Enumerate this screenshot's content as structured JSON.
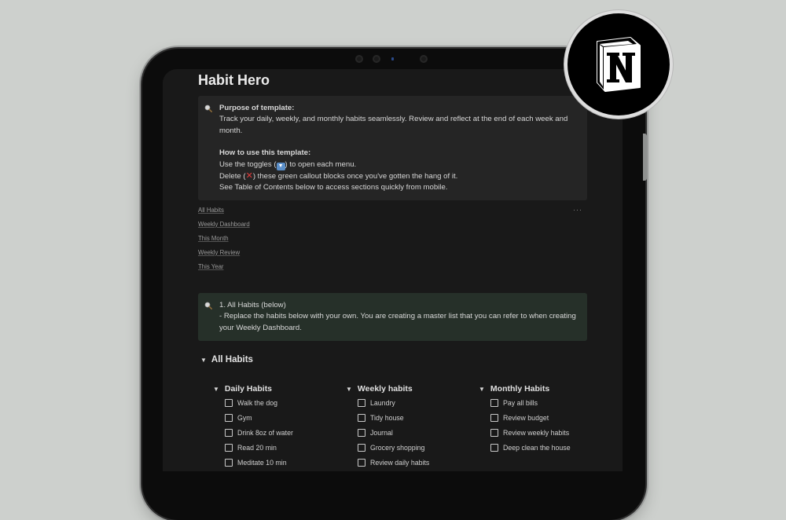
{
  "page": {
    "title": "Habit Hero"
  },
  "callout_purpose": {
    "icon": "magnifier-icon",
    "heading1": "Purpose of template:",
    "text1": "Track your daily, weekly, and monthly habits seamlessly. Review and reflect at the end of each week and month.",
    "heading2": "How to use this template:",
    "line_toggles_a": "Use the toggles (",
    "line_toggles_b": ") to open each menu.",
    "line_delete_a": "Delete (",
    "line_delete_b": ") these green callout blocks once you've gotten the hang of it.",
    "line_toc": "See Table of Contents below to access sections quickly from mobile."
  },
  "toc": {
    "links": [
      "All Habits",
      "Weekly Dashboard",
      "This Month",
      "Weekly Review",
      "This Year"
    ],
    "more": "···"
  },
  "callout_all_habits": {
    "icon": "magnifier-icon",
    "heading": "1. All Habits (below)",
    "text": "- Replace the habits below with your own. You are creating a master list that you can refer to when creating your Weekly Dashboard."
  },
  "all_habits_toggle": {
    "label": "All Habits"
  },
  "columns": [
    {
      "title": "Daily Habits",
      "items": [
        "Walk the dog",
        "Gym",
        "Drink 8oz of water",
        "Read 20 min",
        "Meditate 10 min"
      ]
    },
    {
      "title": "Weekly habits",
      "items": [
        "Laundry",
        "Tidy house",
        "Journal",
        "Grocery shopping",
        "Review daily habits"
      ]
    },
    {
      "title": "Monthly Habits",
      "items": [
        "Pay all bills",
        "Review budget",
        "Review weekly habits",
        "Deep clean the house"
      ]
    }
  ],
  "brand": {
    "logo_icon": "notion-logo-icon",
    "logo_letter": "N"
  }
}
